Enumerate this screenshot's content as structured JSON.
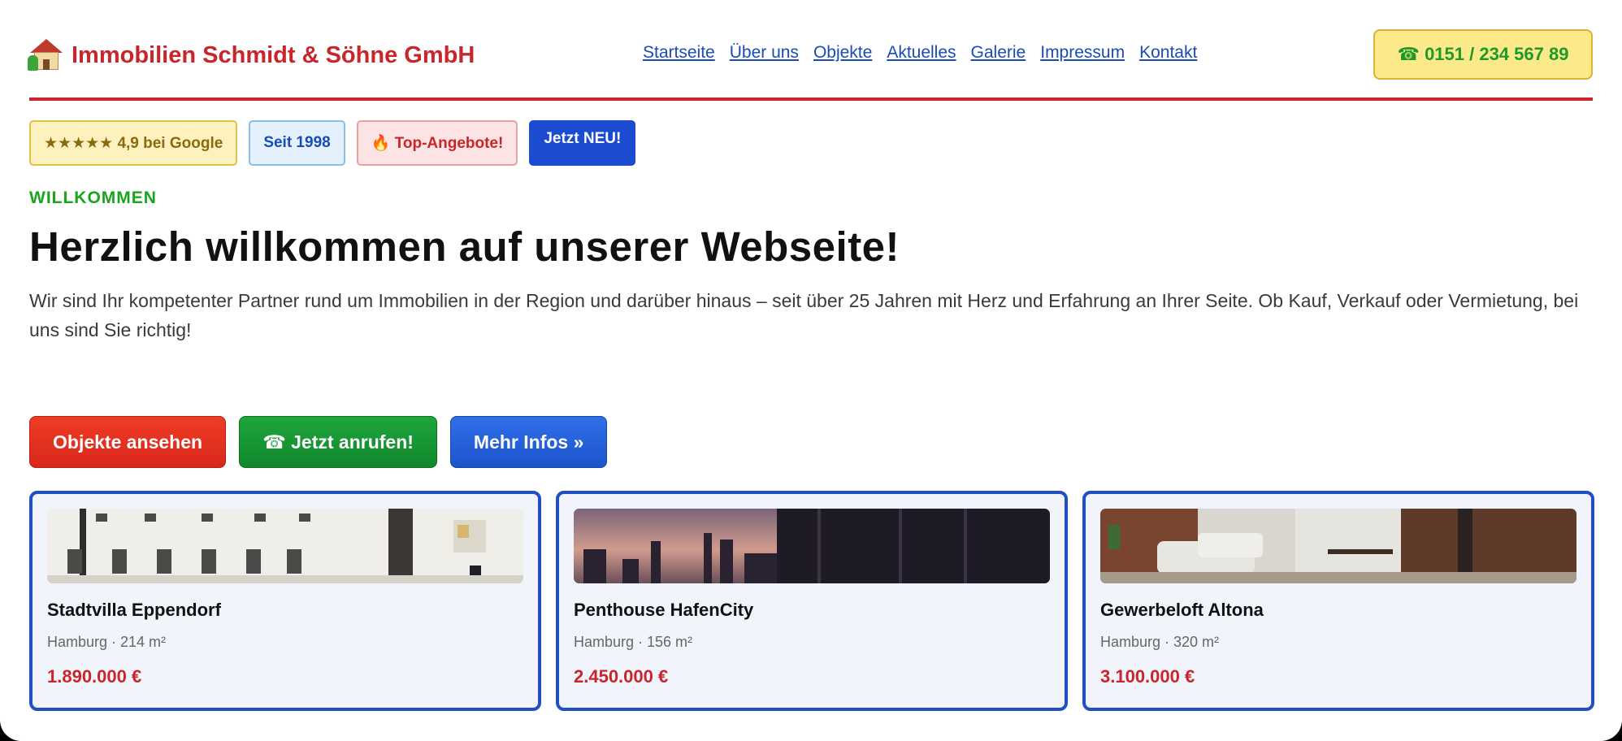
{
  "header": {
    "logo_icon": "house-icon",
    "company_name": "Immobilien Schmidt & Söhne GmbH",
    "nav": [
      "Startseite",
      "Über uns",
      "Objekte",
      "Aktuelles",
      "Galerie",
      "Impressum",
      "Kontakt"
    ],
    "phone": "☎ 0151 / 234 567 89"
  },
  "badges": {
    "rating": "★★★★★ 4,9 bei Google",
    "since": "Seit 1998",
    "top": "🔥 Top-Angebote!",
    "new": "Jetzt NEU!"
  },
  "hero": {
    "eyebrow": "WILLKOMMEN",
    "headline": "Herzlich willkommen auf unserer Webseite!",
    "intro": "Wir sind Ihr kompetenter Partner rund um Immobilien in der Region und darüber hinaus – seit über 25 Jahren mit Herz und Erfahrung an Ihrer Seite. Ob Kauf, Verkauf oder Vermietung, bei uns sind Sie richtig!"
  },
  "ctas": {
    "objects": "Objekte ansehen",
    "call": "☎ Jetzt anrufen!",
    "more": "Mehr Infos »"
  },
  "listings": [
    {
      "title": "Stadtvilla Eppendorf",
      "meta": "Hamburg · 214 m²",
      "price": "1.890.000 €"
    },
    {
      "title": "Penthouse HafenCity",
      "meta": "Hamburg · 156 m²",
      "price": "2.450.000 €"
    },
    {
      "title": "Gewerbeloft Altona",
      "meta": "Hamburg · 320 m²",
      "price": "3.100.000 €"
    }
  ],
  "colors": {
    "brand_red": "#c8262b",
    "nav_blue": "#1a4bb5",
    "accent_green": "#19a41d",
    "card_border": "#1f4fc1"
  }
}
